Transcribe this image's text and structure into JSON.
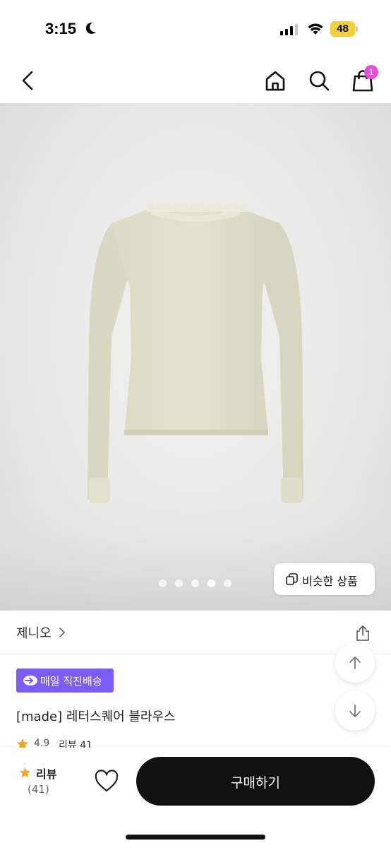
{
  "status_bar": {
    "time": "3:15",
    "battery": "48"
  },
  "nav": {
    "cart_badge": "1"
  },
  "gallery": {
    "total_images": 5,
    "active_index": 3,
    "similar_button_label": "비슷한 상품"
  },
  "brand": {
    "name": "제니오"
  },
  "product": {
    "delivery_badge": "매일 직진배송",
    "title": "[made] 레터스퀘어 블라우스",
    "rating": "4.9",
    "reviews_text": "리뷰 41"
  },
  "bottom_bar": {
    "review_label": "리뷰",
    "review_count": "(41)",
    "buy_label": "구매하기"
  },
  "colors": {
    "accent_purple": "#7b5cf5",
    "badge_pink": "#e54fd6",
    "star_orange": "#f5a623",
    "buy_button": "#111111"
  }
}
